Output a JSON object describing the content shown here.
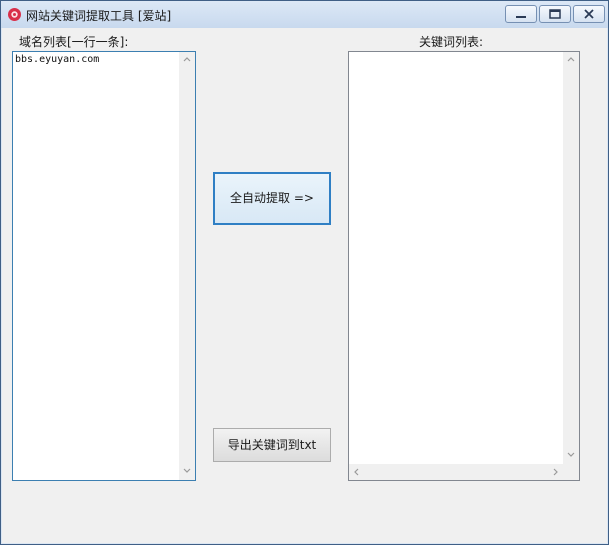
{
  "window": {
    "title": "网站关键词提取工具 [爱站]",
    "controls": [
      "minimize",
      "maximize",
      "close"
    ]
  },
  "left_panel": {
    "label": "域名列表[一行一条]:",
    "content": "bbs.eyuyan.com"
  },
  "right_panel": {
    "label": "关键词列表:",
    "content": ""
  },
  "buttons": {
    "auto_extract": "全自动提取 =>",
    "export": "导出关键词到txt"
  },
  "colors": {
    "focus_border": "#3c7fb1",
    "button_focus": "#2f7fc4",
    "client_bg": "#f0f0f0"
  }
}
